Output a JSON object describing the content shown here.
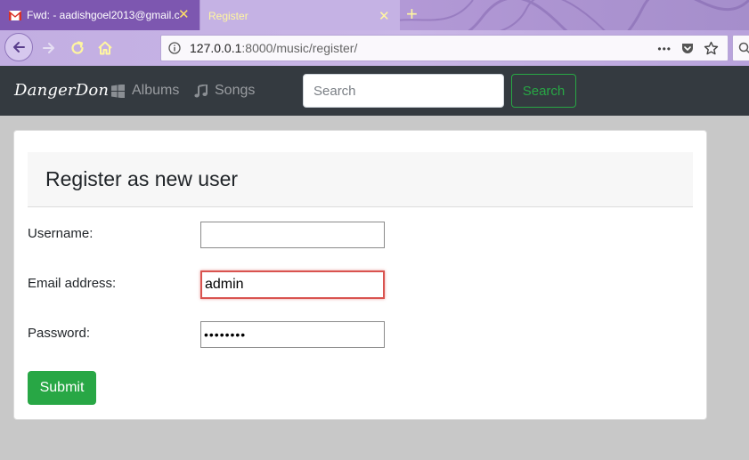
{
  "browser": {
    "tabs": [
      {
        "title": "Fwd: - aadishgoel2013@gmail.c",
        "favicon": "gmail-icon"
      },
      {
        "title": "Register",
        "favicon": ""
      }
    ],
    "url": {
      "host": "127.0.0.1",
      "rest": ":8000/music/register/"
    },
    "actions": {
      "more": "•••",
      "pocket": "pocket-icon",
      "bookmark": "star-icon"
    },
    "icons": {
      "back": "back-arrow-icon",
      "forward": "forward-arrow-icon",
      "reload": "reload-icon",
      "home": "home-icon",
      "info": "info-icon",
      "new_tab": "plus-icon"
    }
  },
  "site": {
    "brand": "DangerDon",
    "nav": [
      {
        "label": "Albums",
        "icon": "grid-icon"
      },
      {
        "label": "Songs",
        "icon": "music-note-icon"
      }
    ],
    "search": {
      "placeholder": "Search",
      "button": "Search"
    }
  },
  "form": {
    "title": "Register as new user",
    "fields": [
      {
        "label": "Username:",
        "value": "",
        "type": "text"
      },
      {
        "label": "Email address:",
        "value": "admin",
        "type": "email"
      },
      {
        "label": "Password:",
        "value": "abcdefgh",
        "type": "password"
      }
    ],
    "submit": "Submit"
  },
  "colors": {
    "navbar_bg": "#343a40",
    "success": "#28a745",
    "tab_active_text": "#fff6a0",
    "error_border": "#d9534f"
  }
}
